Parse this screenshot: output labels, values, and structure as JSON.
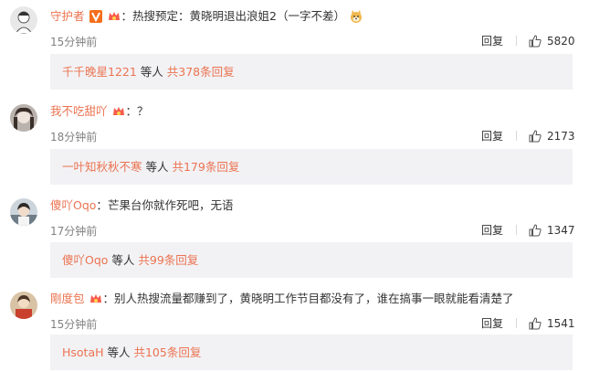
{
  "comments": [
    {
      "user": "守护者",
      "text": "热搜预定：黄晓明退出浪姐2（一字不差）",
      "time": "15分钟前",
      "reply_label": "回复",
      "likes": "5820",
      "sub_user": "千千晚星1221",
      "sub_etc": " 等人 ",
      "sub_more": "共378条回复"
    },
    {
      "user": "我不吃甜吖",
      "text": "？",
      "time": "18分钟前",
      "reply_label": "回复",
      "likes": "2173",
      "sub_user": "一叶知秋秋不寒",
      "sub_etc": " 等人 ",
      "sub_more": "共179条回复"
    },
    {
      "user": "傻吖Oqo",
      "text": "芒果台你就作死吧，无语",
      "time": "17分钟前",
      "reply_label": "回复",
      "likes": "1347",
      "sub_user": "傻吖Oqo",
      "sub_etc": " 等人 ",
      "sub_more": "共99条回复"
    },
    {
      "user": "剛度包",
      "text": "别人热搜流量都赚到了，黄晓明工作节目都没有了，谁在搞事一眼就能看清楚了",
      "time": "15分钟前",
      "reply_label": "回复",
      "likes": "1541",
      "sub_user": "HsotaH",
      "sub_etc": " 等人 ",
      "sub_more": "共105条回复"
    }
  ],
  "colors": {
    "username": "#eb7350",
    "subbox": "#f2f2f5",
    "time": "#808080"
  },
  "icons": [
    "avatar",
    "vip-v-badge",
    "member-crown-badge",
    "doge-emoji",
    "thumbs-up-icon"
  ]
}
